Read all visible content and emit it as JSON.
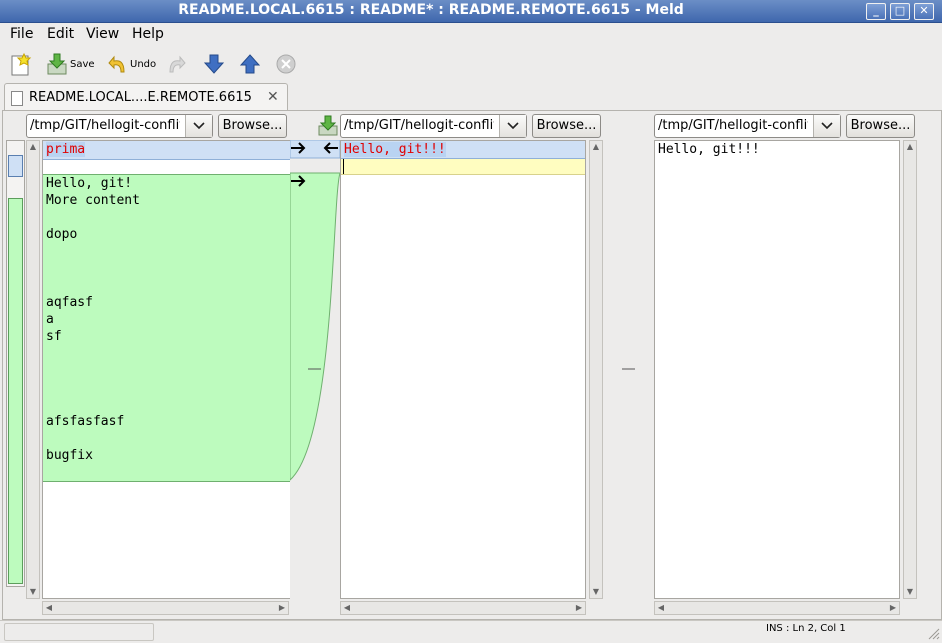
{
  "window": {
    "title": "README.LOCAL.6615 : README* : README.REMOTE.6615 - Meld"
  },
  "menu": {
    "file": "File",
    "edit": "Edit",
    "view": "View",
    "help": "Help"
  },
  "toolbar": {
    "save": "Save",
    "undo": "Undo"
  },
  "tab": {
    "label": "README.LOCAL....E.REMOTE.6615"
  },
  "panes": {
    "left": {
      "path": "/tmp/GIT/hellogit-conflit",
      "browse": "Browse..."
    },
    "middle": {
      "path": "/tmp/GIT/hellogit-conflit",
      "browse": "Browse..."
    },
    "right": {
      "path": "/tmp/GIT/hellogit-conflit",
      "browse": "Browse..."
    }
  },
  "left_text": {
    "l1": "prima",
    "l2": "Hello, git!",
    "l3": "More content",
    "l4": "dopo",
    "l5": "aqfasf",
    "l6": "a",
    "l7": "sf",
    "l8": "afsfasfasf",
    "l9": "bugfix"
  },
  "middle_text": {
    "l1": "Hello, git!!!"
  },
  "right_text": {
    "l1": "Hello, git!!!"
  },
  "status": {
    "cursor": "INS : Ln 2, Col 1"
  },
  "colors": {
    "insert": "#bdfbbe",
    "change": "#cfe0f5",
    "conflict": "#fffdc0",
    "changed_text": "#e00000"
  }
}
